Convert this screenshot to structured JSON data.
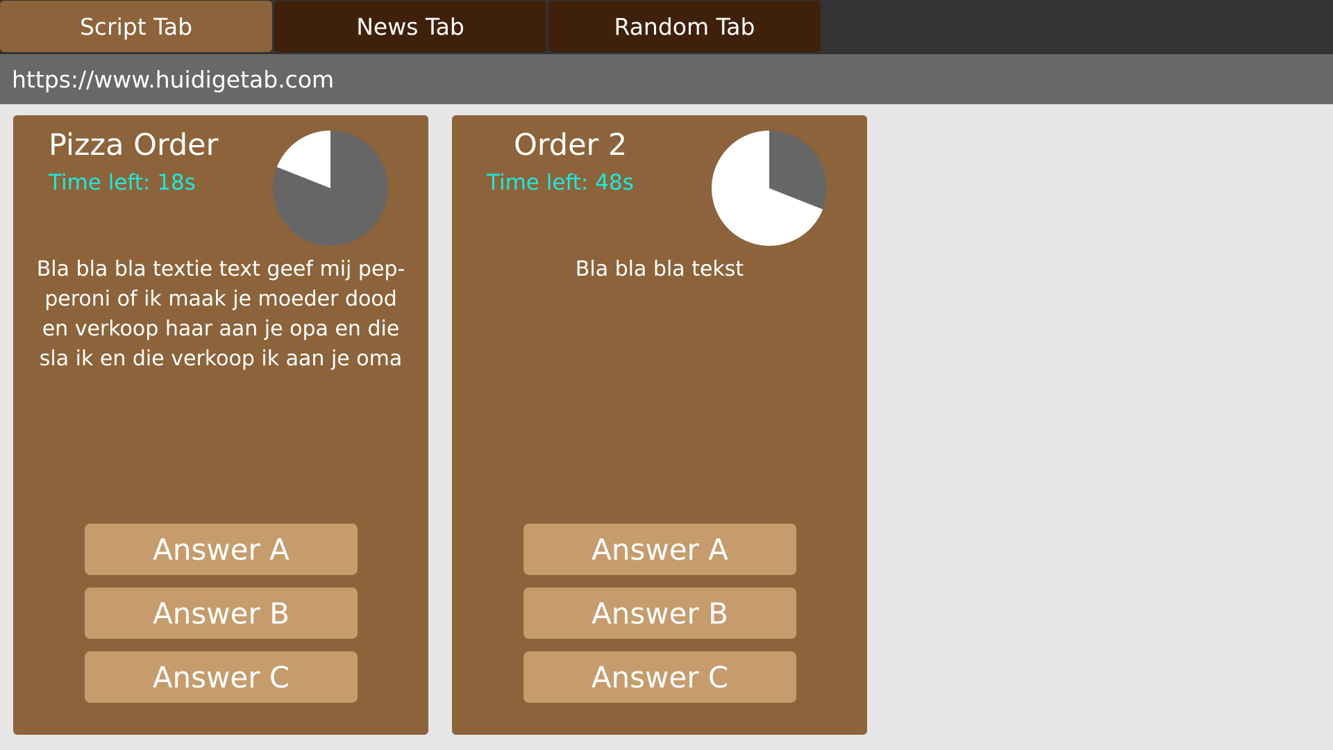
{
  "tabs": [
    {
      "label": "Script Tab",
      "active": true
    },
    {
      "label": "News Tab",
      "active": false
    },
    {
      "label": "Random Tab",
      "active": false
    }
  ],
  "url": "https://www.huidigetab.com",
  "colors": {
    "tab_active": "#8c633a",
    "tab_inactive": "#3f210b",
    "card_background": "#8c633a",
    "answer_button": "#c69c6d",
    "timer_text": "#1ee8dc",
    "pie_remaining": "#666666",
    "pie_elapsed": "#ffffff"
  },
  "orders": [
    {
      "title": "Pizza Order",
      "time_left": "Time left: 18s",
      "timer_elapsed_fraction": 0.19,
      "text": "Bla bla bla textie text geef mij pep- peroni of ik maak je moeder dood en verkoop haar aan je opa en die sla ik en die verkoop ik aan je oma",
      "answers": [
        "Answer A",
        "Answer B",
        "Answer C"
      ]
    },
    {
      "title": "Order 2",
      "time_left": "Time left: 48s",
      "timer_elapsed_fraction": 0.69,
      "text": "Bla bla bla tekst",
      "answers": [
        "Answer A",
        "Answer B",
        "Answer C"
      ]
    }
  ]
}
